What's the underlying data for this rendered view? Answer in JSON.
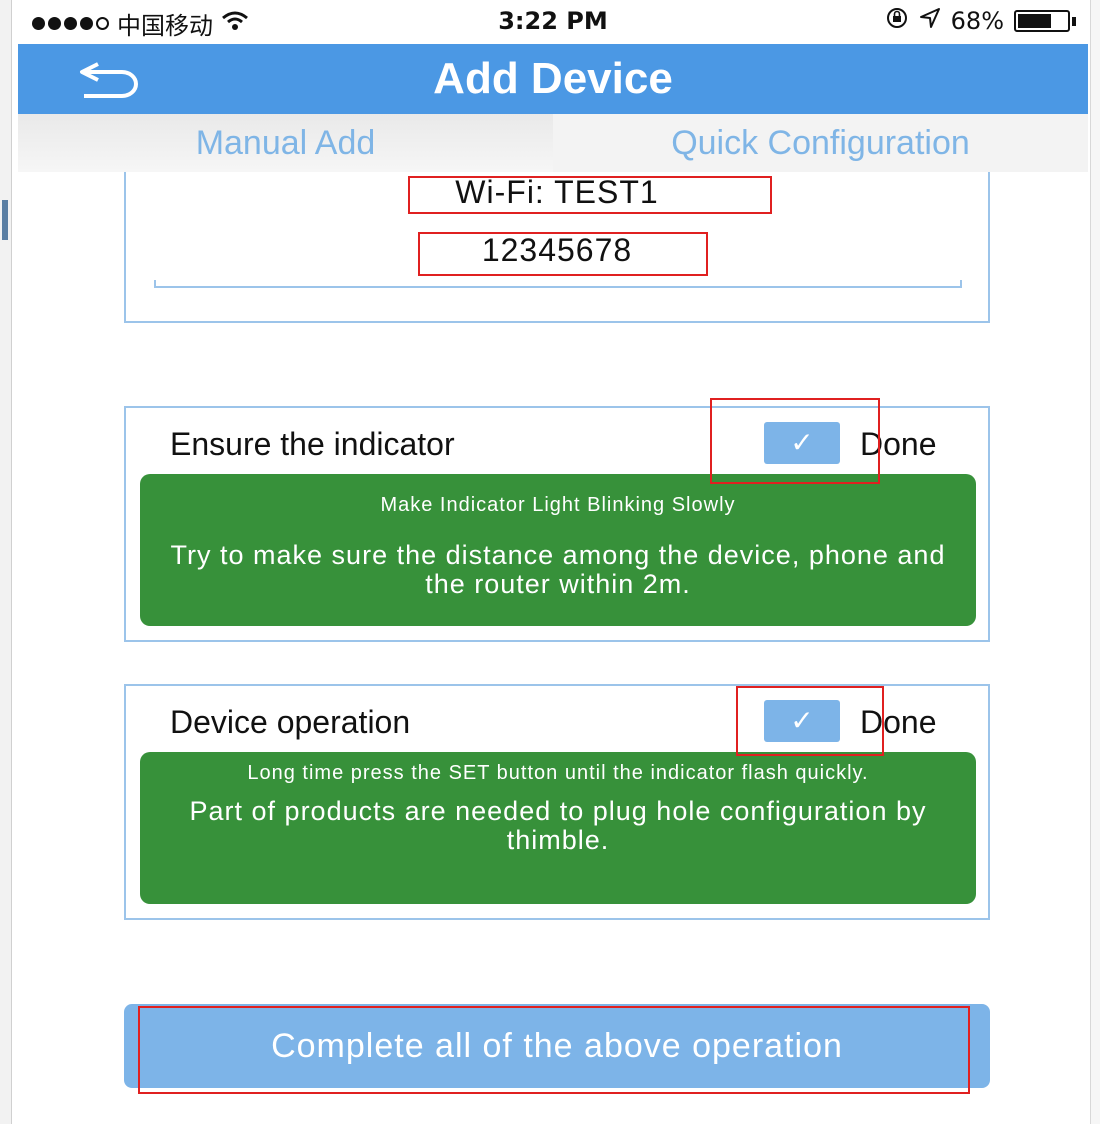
{
  "status_bar": {
    "carrier": "中国移动",
    "time": "3:22 PM",
    "battery_percent": "68%",
    "battery_level": 0.68
  },
  "header": {
    "title": "Add Device",
    "back_icon": "back-arrow-icon"
  },
  "tabs": [
    {
      "label": "Manual Add"
    },
    {
      "label": "Quick Configuration"
    }
  ],
  "wifi": {
    "name": "Wi-Fi:  TEST1",
    "password": "12345678"
  },
  "steps": [
    {
      "title": "Ensure the indicator",
      "done_label": "Done",
      "checked": true,
      "hint_small": "Make Indicator Light Blinking Slowly",
      "hint_large": "Try to make sure the distance among the device, phone and the router within 2m."
    },
    {
      "title": "Device operation",
      "done_label": "Done",
      "checked": true,
      "hint_small": "Long time press the SET button until the indicator flash quickly.",
      "hint_large": "Part of products are needed to plug hole configuration by thimble."
    }
  ],
  "complete_button": {
    "label": "Complete all of the above operation"
  },
  "colors": {
    "header": "#4b98e4",
    "tab_text": "#7fb5e6",
    "card_border": "#9cc4ea",
    "checkbox": "#7db4e8",
    "hint_panel": "#37913a",
    "annotation": "#e02020"
  }
}
